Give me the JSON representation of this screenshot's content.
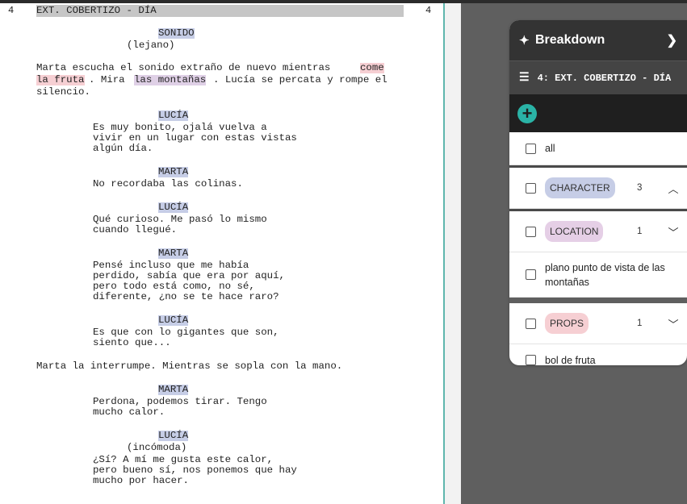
{
  "script": {
    "scene_number": "4",
    "scene_heading": "EXT. COBERTIZO - DÍA",
    "lines": [
      {
        "type": "character",
        "text": "SONIDO"
      },
      {
        "type": "paren",
        "text": "(lejano)"
      },
      {
        "type": "action",
        "text": "Marta escucha el sonido extraño de nuevo mientras "
      },
      {
        "type": "action_hl_props",
        "text": "come"
      },
      {
        "type": "action_hl_props2",
        "text": "la fruta"
      },
      {
        "type": "action_mid",
        "text": ". Mira "
      },
      {
        "type": "action_hl_loc",
        "text": "las montañas"
      },
      {
        "type": "action_end",
        "text": ". Lucía se percata y rompe el"
      },
      {
        "type": "action3",
        "text": "silencio."
      },
      {
        "type": "character",
        "text": "LUCÍA"
      },
      {
        "type": "dialogue",
        "text": "Es muy bonito, ojalá vuelva a"
      },
      {
        "type": "dialogue",
        "text": "vivir en un lugar con estas vistas"
      },
      {
        "type": "dialogue",
        "text": "algún día."
      },
      {
        "type": "character",
        "text": "MARTA"
      },
      {
        "type": "dialogue",
        "text": "No recordaba las colinas."
      },
      {
        "type": "character",
        "text": "LUCÍA"
      },
      {
        "type": "dialogue",
        "text": "Qué curioso. Me pasó lo mismo"
      },
      {
        "type": "dialogue",
        "text": "cuando llegué."
      },
      {
        "type": "character",
        "text": "MARTA"
      },
      {
        "type": "dialogue",
        "text": "Pensé incluso que me había"
      },
      {
        "type": "dialogue",
        "text": "perdido, sabía que era por aquí,"
      },
      {
        "type": "dialogue",
        "text": "pero todo está como, no sé,"
      },
      {
        "type": "dialogue",
        "text": "diferente, ¿no se te hace raro?"
      },
      {
        "type": "character",
        "text": "LUCÍA"
      },
      {
        "type": "dialogue",
        "text": "Es que con lo gigantes que son,"
      },
      {
        "type": "dialogue",
        "text": "siento que..."
      },
      {
        "type": "action",
        "text": "Marta la interrumpe. Mientras se sopla con la mano."
      },
      {
        "type": "character",
        "text": "MARTA"
      },
      {
        "type": "dialogue",
        "text": "Perdona, podemos tirar. Tengo"
      },
      {
        "type": "dialogue",
        "text": "mucho calor."
      },
      {
        "type": "character",
        "text": "LUCÍA"
      },
      {
        "type": "paren",
        "text": "(incómoda)"
      },
      {
        "type": "dialogue",
        "text": "¿Sí? A mí me gusta este calor,"
      },
      {
        "type": "dialogue",
        "text": "pero bueno sí, nos ponemos que hay"
      },
      {
        "type": "dialogue",
        "text": "mucho por hacer."
      }
    ]
  },
  "panel": {
    "title": "Breakdown",
    "scene_label": "4: EXT. COBERTIZO - DÍA",
    "all_label": "all",
    "categories": [
      {
        "name": "CHARACTER",
        "count": "3",
        "expanded": true,
        "color": "#c6cde6",
        "items": []
      },
      {
        "name": "LOCATION",
        "count": "1",
        "expanded": false,
        "color": "#e5cfe6",
        "items": [
          "plano punto de vista de las montañas"
        ]
      },
      {
        "name": "PROPS",
        "count": "1",
        "expanded": false,
        "color": "#f6cfd3",
        "items": [
          "bol de fruta"
        ]
      }
    ]
  }
}
